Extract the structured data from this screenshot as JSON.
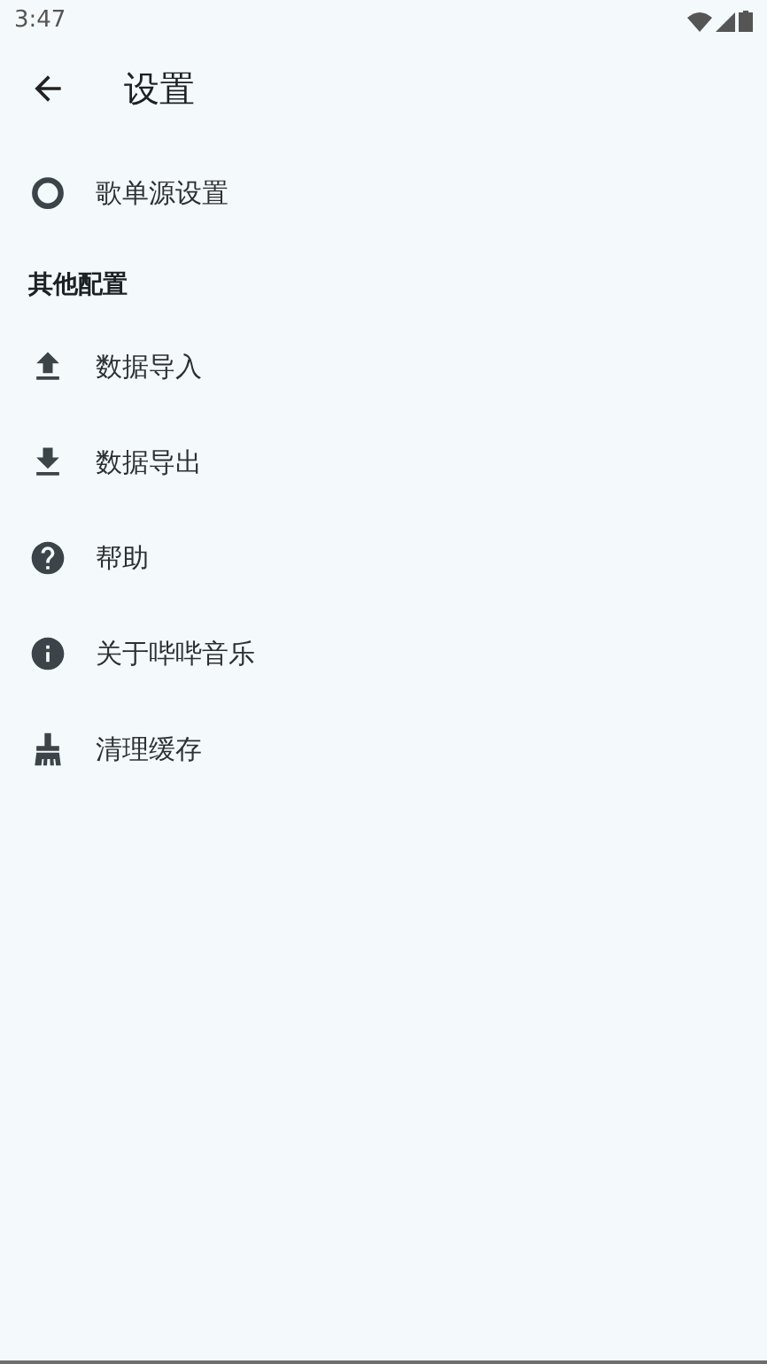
{
  "status_bar": {
    "time": "3:47"
  },
  "app_bar": {
    "title": "设置"
  },
  "top_items": [
    {
      "kind": "ring",
      "label": "歌单源设置"
    }
  ],
  "section": {
    "title": "其他配置",
    "items": [
      {
        "kind": "upload",
        "label": "数据导入"
      },
      {
        "kind": "download",
        "label": "数据导出"
      },
      {
        "kind": "help",
        "label": "帮助"
      },
      {
        "kind": "info",
        "label": "关于哔哔音乐"
      },
      {
        "kind": "broom",
        "label": "清理缓存"
      }
    ]
  }
}
